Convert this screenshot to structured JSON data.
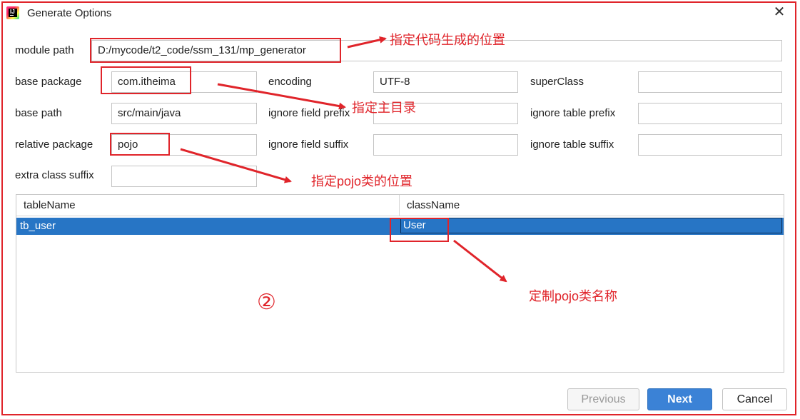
{
  "window": {
    "title": "Generate Options"
  },
  "form": {
    "module_path": {
      "label": "module path",
      "value": "D:/mycode/t2_code/ssm_131/mp_generator"
    },
    "base_package": {
      "label": "base package",
      "value": "com.itheima"
    },
    "base_path": {
      "label": "base path",
      "value": "src/main/java"
    },
    "relative_package": {
      "label": "relative package",
      "value": "pojo"
    },
    "extra_class_suffix": {
      "label": "extra class suffix",
      "value": ""
    },
    "encoding": {
      "label": "encoding",
      "value": "UTF-8"
    },
    "ignore_field_prefix": {
      "label": "ignore field prefix",
      "value": ""
    },
    "ignore_field_suffix": {
      "label": "ignore field suffix",
      "value": ""
    },
    "super_class": {
      "label": "superClass",
      "value": ""
    },
    "ignore_table_prefix": {
      "label": "ignore table prefix",
      "value": ""
    },
    "ignore_table_suffix": {
      "label": "ignore table suffix",
      "value": ""
    }
  },
  "table": {
    "columns": [
      "tableName",
      "className"
    ],
    "rows": [
      {
        "tableName": "tb_user",
        "className": "User"
      }
    ]
  },
  "buttons": {
    "previous": "Previous",
    "next": "Next",
    "cancel": "Cancel"
  },
  "annotations": {
    "module_path_note": "指定代码生成的位置",
    "base_package_note": "指定主目录",
    "pojo_note": "指定pojo类的位置",
    "class_name_note": "定制pojo类名称",
    "step_marker": "②"
  },
  "colors": {
    "annotation": "#e0242a",
    "selection": "#2775c5",
    "primary_button": "#3b82d6"
  }
}
